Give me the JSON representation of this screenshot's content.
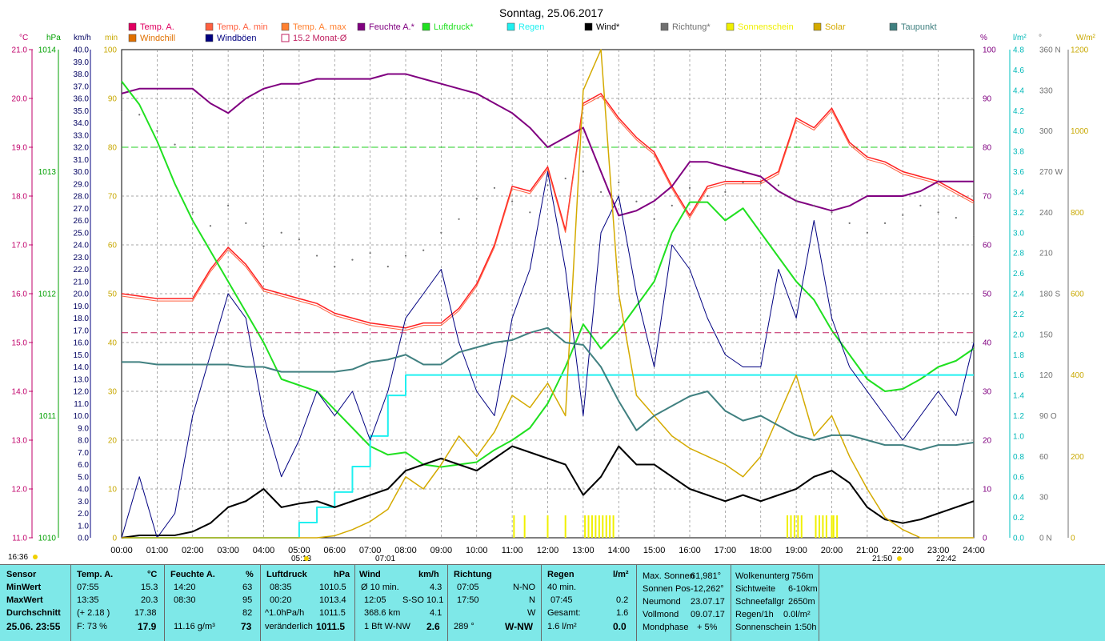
{
  "title": "Sonntag, 25.06.2017",
  "colors": {
    "temp": "#ff2020",
    "temp_min": "#ff6040",
    "temp_max": "#ff9050",
    "humidity": "#800080",
    "pressure": "#20e020",
    "rain": "#20f0f0",
    "wind": "#000000",
    "gusts": "#000080",
    "direction": "#707070",
    "sunshine": "#f0f000",
    "solar": "#d4aa00",
    "dewpoint": "#408080",
    "avg15": "#c02060",
    "panel_bg": "#7ee8e8"
  },
  "legend": [
    {
      "label": "Temp. A.",
      "color": "#e00060",
      "kind": "filled"
    },
    {
      "label": "Temp. A. min",
      "color": "#ff6040",
      "kind": "filled"
    },
    {
      "label": "Temp. A. max",
      "color": "#ff8030",
      "kind": "filled"
    },
    {
      "label": "Feuchte A.*",
      "color": "#800080",
      "kind": "filled"
    },
    {
      "label": "Luftdruck*",
      "color": "#20e020",
      "kind": "filled"
    },
    {
      "label": "Regen",
      "color": "#20f0f0",
      "kind": "filled"
    },
    {
      "label": "Wind*",
      "color": "#000000",
      "kind": "filled"
    },
    {
      "label": "Richtung*",
      "color": "#707070",
      "kind": "filled"
    },
    {
      "label": "Sonnenschein",
      "color": "#f0f000",
      "kind": "filled"
    },
    {
      "label": "Solar",
      "color": "#d4aa00",
      "kind": "filled"
    },
    {
      "label": "Taupunkt",
      "color": "#408080",
      "kind": "filled"
    },
    {
      "label": "Windchill",
      "color": "#e07000",
      "kind": "filled"
    },
    {
      "label": "Windböen",
      "color": "#000080",
      "kind": "filled"
    },
    {
      "label": "15.2 Monat-Ø",
      "color": "#c02060",
      "kind": "hollow"
    }
  ],
  "axes": {
    "temp": {
      "unit": "°C",
      "ticks": [
        "21.0",
        "20.0",
        "19.0",
        "18.0",
        "17.0",
        "16.0",
        "15.0",
        "14.0",
        "13.0",
        "12.0",
        "11.0"
      ]
    },
    "pressure": {
      "unit": "hPa",
      "ticks": [
        "1014",
        "1013",
        "1012",
        "1011",
        "1010"
      ]
    },
    "wind": {
      "unit": "km/h",
      "ticks": [
        "40.0",
        "39.0",
        "38.0",
        "37.0",
        "36.0",
        "35.0",
        "34.0",
        "33.0",
        "32.0",
        "31.0",
        "30.0",
        "29.0",
        "28.0",
        "27.0",
        "26.0",
        "25.0",
        "24.0",
        "23.0",
        "22.0",
        "21.0",
        "20.0",
        "19.0",
        "18.0",
        "17.0",
        "16.0",
        "15.0",
        "14.0",
        "13.0",
        "12.0",
        "11.0",
        "10.0",
        "9.0",
        "8.0",
        "7.0",
        "6.0",
        "5.0",
        "4.0",
        "3.0",
        "2.0",
        "1.0",
        "0.0"
      ]
    },
    "sunmin": {
      "unit": "min",
      "ticks": [
        "100",
        "90",
        "80",
        "70",
        "60",
        "50",
        "40",
        "30",
        "20",
        "10",
        "0"
      ]
    },
    "percent": {
      "unit": "%",
      "ticks": [
        "100",
        "90",
        "80",
        "70",
        "60",
        "50",
        "40",
        "30",
        "20",
        "10",
        "0"
      ]
    },
    "rain": {
      "unit": "l/m²",
      "ticks": [
        "4.8",
        "4.6",
        "4.4",
        "4.2",
        "4.0",
        "3.8",
        "3.6",
        "3.4",
        "3.2",
        "3.0",
        "2.8",
        "2.6",
        "2.4",
        "2.2",
        "2.0",
        "1.8",
        "1.6",
        "1.4",
        "1.2",
        "1.0",
        "0.8",
        "0.6",
        "0.4",
        "0.2",
        "0.0"
      ]
    },
    "direction": {
      "unit": "°",
      "ticks": [
        "360 N",
        "330",
        "300",
        "270 W",
        "240",
        "210",
        "180 S",
        "150",
        "120",
        "90  O",
        "60",
        "30",
        "0   N"
      ]
    },
    "solar": {
      "unit": "W/m²",
      "ticks": [
        "1200",
        "1000",
        "800",
        "600",
        "400",
        "200",
        "0"
      ]
    },
    "time": {
      "ticks": [
        "00:00",
        "01:00",
        "02:00",
        "03:00",
        "04:00",
        "05:00",
        "06:00",
        "07:00",
        "08:00",
        "09:00",
        "10:00",
        "11:00",
        "12:00",
        "13:00",
        "14:00",
        "15:00",
        "16:00",
        "17:00",
        "18:00",
        "19:00",
        "20:00",
        "21:00",
        "22:00",
        "23:00",
        "24:00"
      ]
    }
  },
  "sun_markers": {
    "now": "16:36",
    "sunrise": "05:13",
    "noon": "07:01",
    "sunset": "21:50",
    "moon": "22:42"
  },
  "chart_data": {
    "type": "line",
    "title": "Sonntag, 25.06.2017",
    "x_hours": [
      0,
      0.5,
      1,
      1.5,
      2,
      2.5,
      3,
      3.5,
      4,
      4.5,
      5,
      5.5,
      6,
      6.5,
      7,
      7.5,
      8,
      8.5,
      9,
      9.5,
      10,
      10.5,
      11,
      11.5,
      12,
      12.5,
      13,
      13.5,
      14,
      14.5,
      15,
      15.5,
      16,
      16.5,
      17,
      17.5,
      18,
      18.5,
      19,
      19.5,
      20,
      20.5,
      21,
      21.5,
      22,
      22.5,
      23,
      23.5,
      24
    ],
    "xlim": [
      0,
      24
    ],
    "series": [
      {
        "name": "Temp. A.",
        "axis": "temp",
        "values": [
          16.0,
          15.95,
          15.9,
          15.9,
          15.9,
          16.5,
          16.95,
          16.6,
          16.1,
          16.0,
          15.9,
          15.8,
          15.6,
          15.5,
          15.4,
          15.35,
          15.3,
          15.4,
          15.4,
          15.7,
          16.2,
          17.0,
          18.2,
          18.1,
          18.6,
          17.3,
          19.9,
          20.1,
          19.6,
          19.2,
          18.9,
          18.2,
          17.6,
          18.2,
          18.3,
          18.3,
          18.3,
          18.5,
          19.6,
          19.4,
          19.8,
          19.1,
          18.8,
          18.7,
          18.5,
          18.4,
          18.3,
          18.1,
          17.9
        ]
      },
      {
        "name": "Feuchte A.*",
        "axis": "percent",
        "values": [
          91,
          92,
          92,
          92,
          92,
          89,
          87,
          90,
          92,
          93,
          93,
          94,
          94,
          94,
          94,
          95,
          95,
          94,
          93,
          92,
          91,
          89,
          87,
          84,
          80,
          82,
          84,
          75,
          66,
          67,
          69,
          72,
          77,
          77,
          76,
          75,
          74,
          71,
          69,
          68,
          67,
          68,
          70,
          70,
          70,
          71,
          73,
          73,
          73
        ]
      },
      {
        "name": "Luftdruck*",
        "axis": "pressure",
        "values": [
          1013.74,
          1013.55,
          1013.25,
          1012.9,
          1012.6,
          1012.35,
          1012.1,
          1011.85,
          1011.6,
          1011.3,
          1011.25,
          1011.2,
          1011.05,
          1010.9,
          1010.75,
          1010.68,
          1010.7,
          1010.6,
          1010.58,
          1010.6,
          1010.62,
          1010.72,
          1010.8,
          1010.9,
          1011.1,
          1011.4,
          1011.75,
          1011.55,
          1011.7,
          1011.9,
          1012.1,
          1012.5,
          1012.75,
          1012.75,
          1012.6,
          1012.7,
          1012.5,
          1012.3,
          1012.1,
          1011.95,
          1011.7,
          1011.5,
          1011.3,
          1011.2,
          1011.22,
          1011.3,
          1011.4,
          1011.45,
          1011.55
        ]
      },
      {
        "name": "Regen",
        "axis": "rain",
        "values": [
          0,
          0,
          0,
          0,
          0,
          0,
          0,
          0,
          0,
          0,
          0.15,
          0.3,
          0.45,
          0.7,
          1.0,
          1.4,
          1.6,
          1.6,
          1.6,
          1.6,
          1.6,
          1.6,
          1.6,
          1.6,
          1.6,
          1.6,
          1.6,
          1.6,
          1.6,
          1.6,
          1.6,
          1.6,
          1.6,
          1.6,
          1.6,
          1.6,
          1.6,
          1.6,
          1.6,
          1.6,
          1.6,
          1.6,
          1.6,
          1.6,
          1.6,
          1.6,
          1.6,
          1.6,
          1.6
        ]
      },
      {
        "name": "Wind*",
        "axis": "wind",
        "values": [
          0,
          0.2,
          0.2,
          0.2,
          0.5,
          1.2,
          2.5,
          3.0,
          4.0,
          2.5,
          2.8,
          3.0,
          2.5,
          3.0,
          3.5,
          4.0,
          5.5,
          6.0,
          6.5,
          6.0,
          5.5,
          6.5,
          7.5,
          7.0,
          6.5,
          6.0,
          3.5,
          5.0,
          7.5,
          6.0,
          6.0,
          5.0,
          4.0,
          3.5,
          3.0,
          3.5,
          3.0,
          3.5,
          4.0,
          5.0,
          5.5,
          4.5,
          2.5,
          1.5,
          1.2,
          1.5,
          2.0,
          2.5,
          3.0
        ]
      },
      {
        "name": "Windböen",
        "axis": "wind",
        "values": [
          0,
          5,
          0,
          2,
          10,
          15,
          20,
          18,
          10,
          5,
          8,
          12,
          10,
          12,
          8,
          12,
          18,
          20,
          22,
          16,
          12,
          10,
          18,
          22,
          30,
          22,
          10,
          25,
          28,
          20,
          14,
          24,
          22,
          18,
          15,
          14,
          14,
          22,
          18,
          26,
          18,
          14,
          12,
          10,
          8,
          10,
          12,
          10,
          16
        ]
      },
      {
        "name": "Richtung*",
        "axis": "direction",
        "values": [
          315,
          312,
          300,
          290,
          240,
          230,
          245,
          232,
          215,
          225,
          220,
          208,
          200,
          205,
          210,
          200,
          208,
          212,
          225,
          235,
          250,
          258,
          248,
          240,
          260,
          265,
          270,
          255,
          262,
          248,
          235,
          245,
          258,
          252,
          255,
          262,
          262,
          260,
          248,
          245,
          240,
          232,
          225,
          232,
          238,
          245,
          240,
          236,
          222
        ]
      },
      {
        "name": "Solar",
        "axis": "solar",
        "values": [
          0,
          0,
          0,
          0,
          0,
          0,
          0,
          0,
          0,
          0,
          0,
          0,
          5,
          20,
          40,
          70,
          150,
          120,
          180,
          250,
          200,
          260,
          350,
          320,
          380,
          300,
          1100,
          1200,
          600,
          350,
          300,
          250,
          220,
          200,
          180,
          150,
          200,
          300,
          400,
          250,
          300,
          200,
          120,
          50,
          20,
          0,
          0,
          0,
          0
        ]
      },
      {
        "name": "Taupunkt",
        "axis": "temp",
        "values": [
          14.6,
          14.6,
          14.55,
          14.55,
          14.55,
          14.55,
          14.55,
          14.5,
          14.5,
          14.4,
          14.4,
          14.4,
          14.4,
          14.45,
          14.6,
          14.65,
          14.75,
          14.55,
          14.55,
          14.8,
          14.9,
          15.0,
          15.05,
          15.2,
          15.3,
          15.0,
          14.95,
          14.5,
          13.8,
          13.2,
          13.5,
          13.7,
          13.9,
          14.0,
          13.6,
          13.4,
          13.5,
          13.3,
          13.1,
          13.0,
          13.1,
          13.1,
          13.0,
          12.9,
          12.9,
          12.8,
          12.9,
          12.9,
          12.95
        ]
      },
      {
        "name": "15.2 Monat-Ø",
        "axis": "temp",
        "values": [
          15.2,
          15.2
        ]
      }
    ],
    "sunshine_hours": [
      11.05,
      11.35,
      12.0,
      12.5,
      13.05,
      13.15,
      13.25,
      13.35,
      13.45,
      13.55,
      13.65,
      13.75,
      13.85,
      18.75,
      18.85,
      18.95,
      19.05,
      19.15,
      19.55,
      19.65,
      19.75,
      19.85,
      20.0,
      20.05,
      20.15
    ],
    "reference_lines": [
      {
        "axis": "percent",
        "value": 80,
        "color": "#20d020"
      }
    ],
    "ylim_temp": [
      11,
      21
    ],
    "ylim_percent": [
      0,
      100
    ],
    "ylim_wind": [
      0,
      40
    ],
    "ylim_pressure": [
      1010,
      1014
    ],
    "ylim_rain": [
      0,
      4.8
    ],
    "ylim_direction": [
      0,
      360
    ],
    "ylim_solar": [
      0,
      1200
    ],
    "grid": true
  },
  "stats": {
    "headers": {
      "sensor": "Sensor",
      "temp": "Temp. A.",
      "temp_unit": "°C",
      "hum": "Feuchte A.",
      "hum_unit": "%",
      "press": "Luftdruck",
      "press_unit": "hPa",
      "wind": "Wind",
      "wind_unit": "km/h",
      "dir": "Richtung",
      "rain": "Regen",
      "rain_unit": "l/m²"
    },
    "rows": {
      "min": "MinWert",
      "max": "MaxWert",
      "avg": "Durchschnitt",
      "date": "25.06. 23:55"
    },
    "temp": {
      "min_time": "07:55",
      "min": "15.3",
      "max_time": "13:35",
      "max": "20.3",
      "avg_delta": "(+ 2.18 )",
      "avg": "17.38",
      "dew": "F: 73 %",
      "cur": "17.9"
    },
    "hum": {
      "min_time": "14:20",
      "min": "63",
      "max_time": "08:30",
      "max": "95",
      "avg": "82",
      "abs": "11.16 g/m³",
      "cur": "73"
    },
    "press": {
      "min_time": "08:35",
      "min": "1010.5",
      "max_time": "00:20",
      "max": "1013.4",
      "trend": "^1.0hPa/h",
      "avg": "1011.5",
      "trend_word": "veränderlich",
      "cur": "1011.5"
    },
    "wind": {
      "r1a": "Ø 10 min.",
      "r1b": "4.3",
      "r2a": "12:05",
      "r2b": "S-SO 10.1",
      "r3a": "368.6 km",
      "r3b": "4.1",
      "r4a": "1 Bft W-NW",
      "r4b": "2.6"
    },
    "dir": {
      "r1a": "07:05",
      "r1b": "N-NO",
      "r2a": "17:50",
      "r2b": "N",
      "r3b": "W",
      "r4a": "289 °",
      "r4b": "W-NW"
    },
    "rain": {
      "r1a": "40 min.",
      "r2a": "07:45",
      "r2b": "0.2",
      "r3a": "Gesamt:",
      "r3b": "1.6",
      "r4a": "1.6 l/m²",
      "r4b": "0.0"
    },
    "astro": [
      [
        "Max. Sonnen",
        "61,981°"
      ],
      [
        "Sonnen Pos",
        "-12,262°"
      ],
      [
        "Neumond",
        "23.07.17"
      ],
      [
        "Vollmond",
        "09.07.17"
      ],
      [
        "Mondphase",
        "+ 5%"
      ]
    ],
    "weather": [
      [
        "Wolkenunterg",
        "756m"
      ],
      [
        "Sichtweite",
        "6-10km"
      ],
      [
        "Schneefallgr",
        "2650m"
      ],
      [
        "Regen/1h",
        "0.0l/m²"
      ],
      [
        "Sonnenschein",
        "1:50h"
      ]
    ]
  }
}
